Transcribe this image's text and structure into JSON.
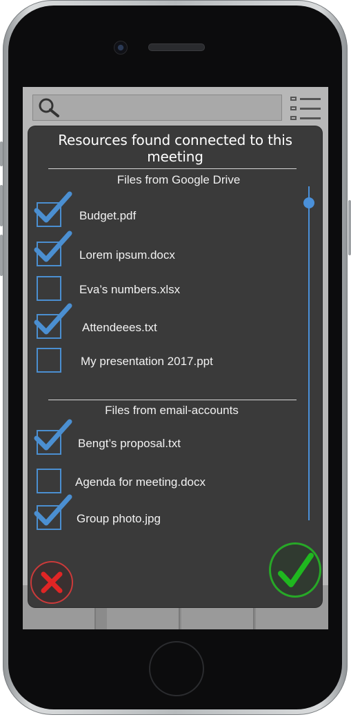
{
  "dialog": {
    "title": "Resources found connected to this meeting",
    "sections": [
      {
        "header": "Files from Google Drive",
        "items": [
          {
            "label": "Budget.pdf",
            "checked": true
          },
          {
            "label": "Lorem ipsum.docx",
            "checked": true
          },
          {
            "label": "Eva’s numbers.xlsx",
            "checked": false
          },
          {
            "label": "Attendeees.txt",
            "checked": true
          },
          {
            "label": "My presentation 2017.ppt",
            "checked": false
          }
        ]
      },
      {
        "header": "Files from email-accounts",
        "items": [
          {
            "label": "Bengt’s proposal.txt",
            "checked": true
          },
          {
            "label": "Agenda for meeting.docx",
            "checked": false
          },
          {
            "label": "Group photo.jpg",
            "checked": true
          }
        ]
      }
    ]
  },
  "colors": {
    "dialog_bg": "#3a3a3a",
    "checkbox_blue": "#4b8fd1",
    "cancel_red": "#cc3a3a",
    "confirm_green": "#27a827"
  },
  "icons": {
    "search": "search-icon",
    "menu": "list-menu-icon",
    "cancel": "close-icon",
    "confirm": "checkmark-icon"
  }
}
